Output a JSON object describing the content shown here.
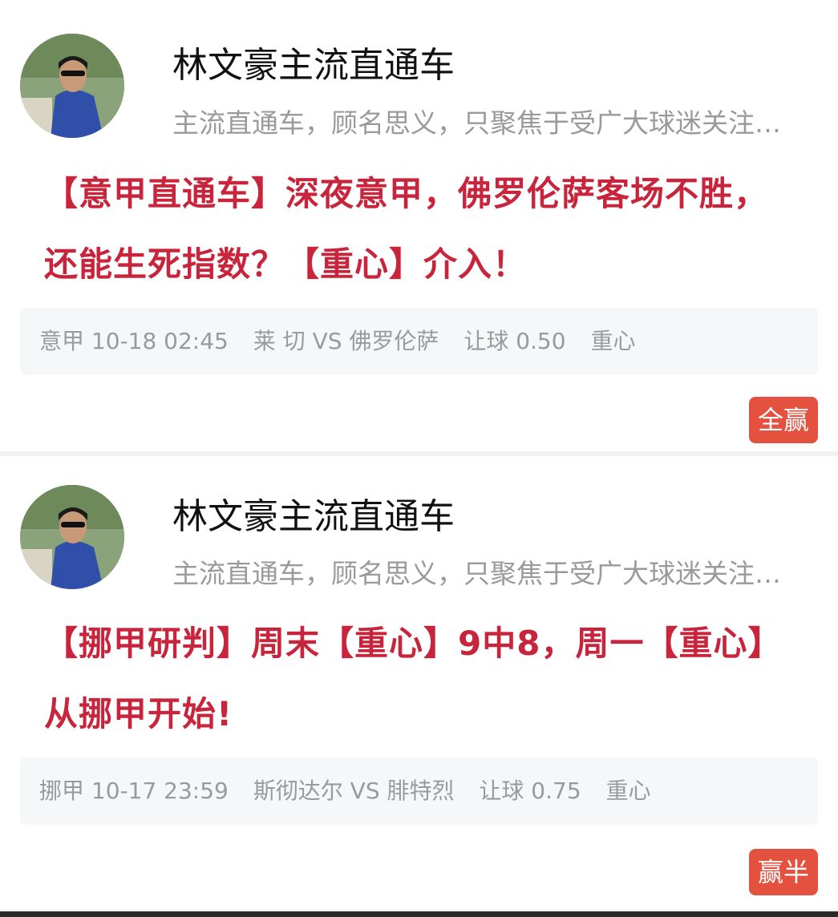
{
  "posts": [
    {
      "author": "林文豪主流直通车",
      "bio": "主流直通车，顾名思义，只聚焦于受广大球迷关注…",
      "headline": "【意甲直通车】深夜意甲，佛罗伦萨客场不胜，还能生死指数？【重心】介入！",
      "match": {
        "league_time": "意甲 10-18 02:45",
        "teams": "莱 切 VS 佛罗伦萨",
        "handicap": "让球 0.50",
        "tag": "重心"
      },
      "result_badge": "全赢"
    },
    {
      "author": "林文豪主流直通车",
      "bio": "主流直通车，顾名思义，只聚焦于受广大球迷关注…",
      "headline": "【挪甲研判】周末【重心】9中8，周一【重心】从挪甲开始!",
      "match": {
        "league_time": "挪甲 10-17 23:59",
        "teams": "斯彻达尔 VS 腓特烈",
        "handicap": "让球 0.75",
        "tag": "重心"
      },
      "result_badge": "赢半"
    }
  ],
  "colors": {
    "headline": "#c8243b",
    "badge": "#e4513f",
    "muted_text": "#9a9a9a"
  }
}
